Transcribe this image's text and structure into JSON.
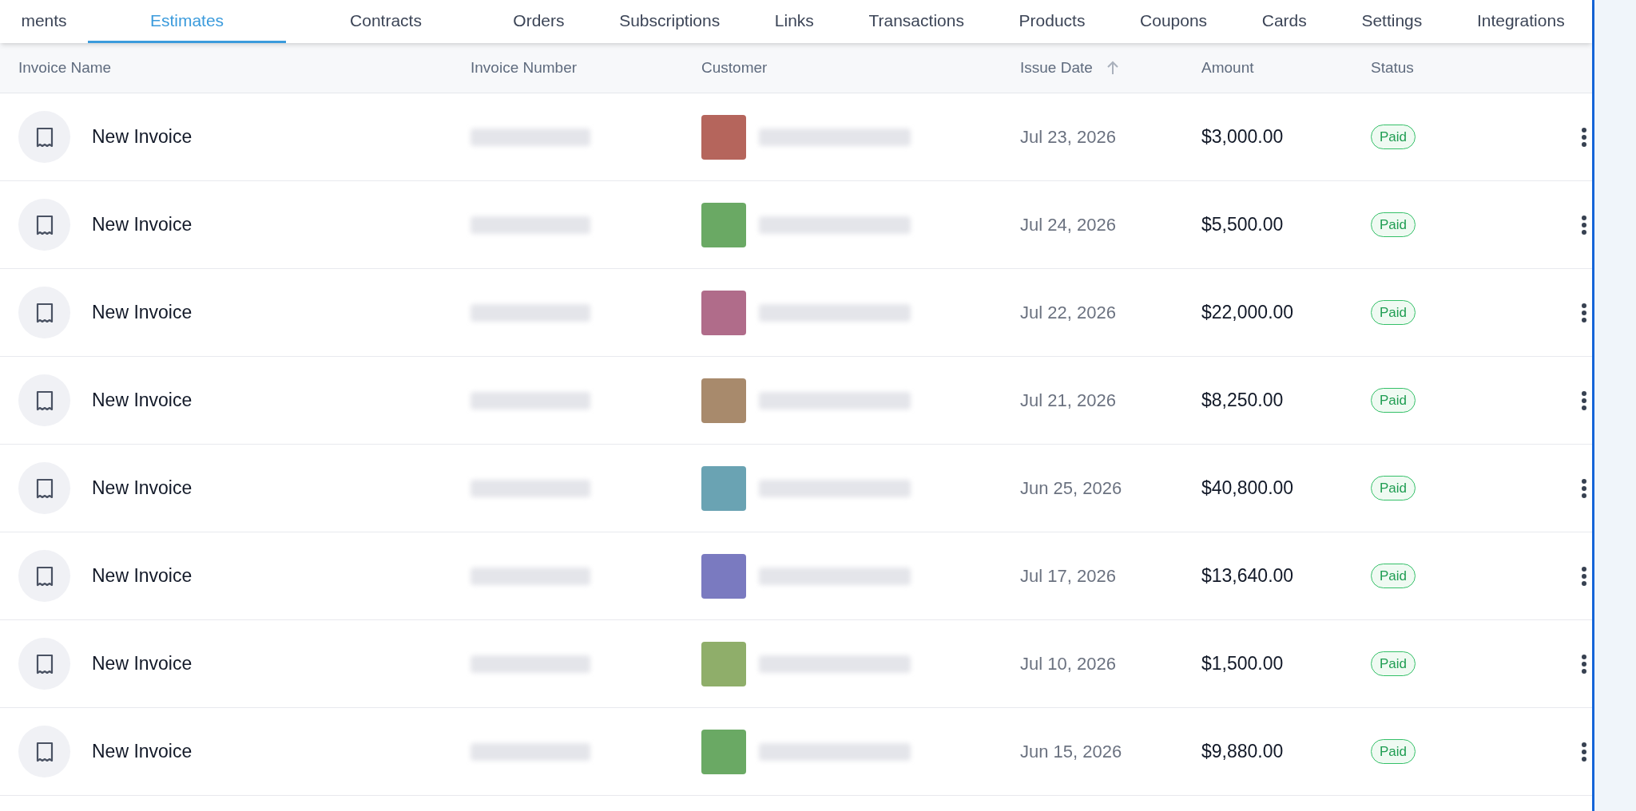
{
  "nav": {
    "tabs": [
      {
        "label": "ments",
        "selected": false
      },
      {
        "label": "Estimates",
        "selected": true
      },
      {
        "label": "Contracts",
        "selected": false
      },
      {
        "label": "Orders",
        "selected": false
      },
      {
        "label": "Subscriptions",
        "selected": false
      },
      {
        "label": "Links",
        "selected": false
      },
      {
        "label": "Transactions",
        "selected": false
      },
      {
        "label": "Products",
        "selected": false
      },
      {
        "label": "Coupons",
        "selected": false
      },
      {
        "label": "Cards",
        "selected": false
      },
      {
        "label": "Settings",
        "selected": false
      },
      {
        "label": "Integrations",
        "selected": false
      }
    ]
  },
  "table": {
    "columns": [
      "Invoice Name",
      "Invoice Number",
      "Customer",
      "Issue Date",
      "Amount",
      "Status"
    ],
    "rows": [
      {
        "name": "New Invoice",
        "color": "#b5655c",
        "issue_date": "Jul 23, 2026",
        "amount": "$3,000.00",
        "status": "Paid"
      },
      {
        "name": "New Invoice",
        "color": "#6aa964",
        "issue_date": "Jul 24, 2026",
        "amount": "$5,500.00",
        "status": "Paid"
      },
      {
        "name": "New Invoice",
        "color": "#b06c8a",
        "issue_date": "Jul 22, 2026",
        "amount": "$22,000.00",
        "status": "Paid"
      },
      {
        "name": "New Invoice",
        "color": "#a88a6c",
        "issue_date": "Jul 21, 2026",
        "amount": "$8,250.00",
        "status": "Paid"
      },
      {
        "name": "New Invoice",
        "color": "#6aa3b3",
        "issue_date": "Jun 25, 2026",
        "amount": "$40,800.00",
        "status": "Paid"
      },
      {
        "name": "New Invoice",
        "color": "#7a7ac0",
        "issue_date": "Jul 17, 2026",
        "amount": "$13,640.00",
        "status": "Paid"
      },
      {
        "name": "New Invoice",
        "color": "#8fae6a",
        "issue_date": "Jul 10, 2026",
        "amount": "$1,500.00",
        "status": "Paid"
      },
      {
        "name": "New Invoice",
        "color": "#6aa964",
        "issue_date": "Jun 15, 2026",
        "amount": "$9,880.00",
        "status": "Paid"
      }
    ]
  }
}
